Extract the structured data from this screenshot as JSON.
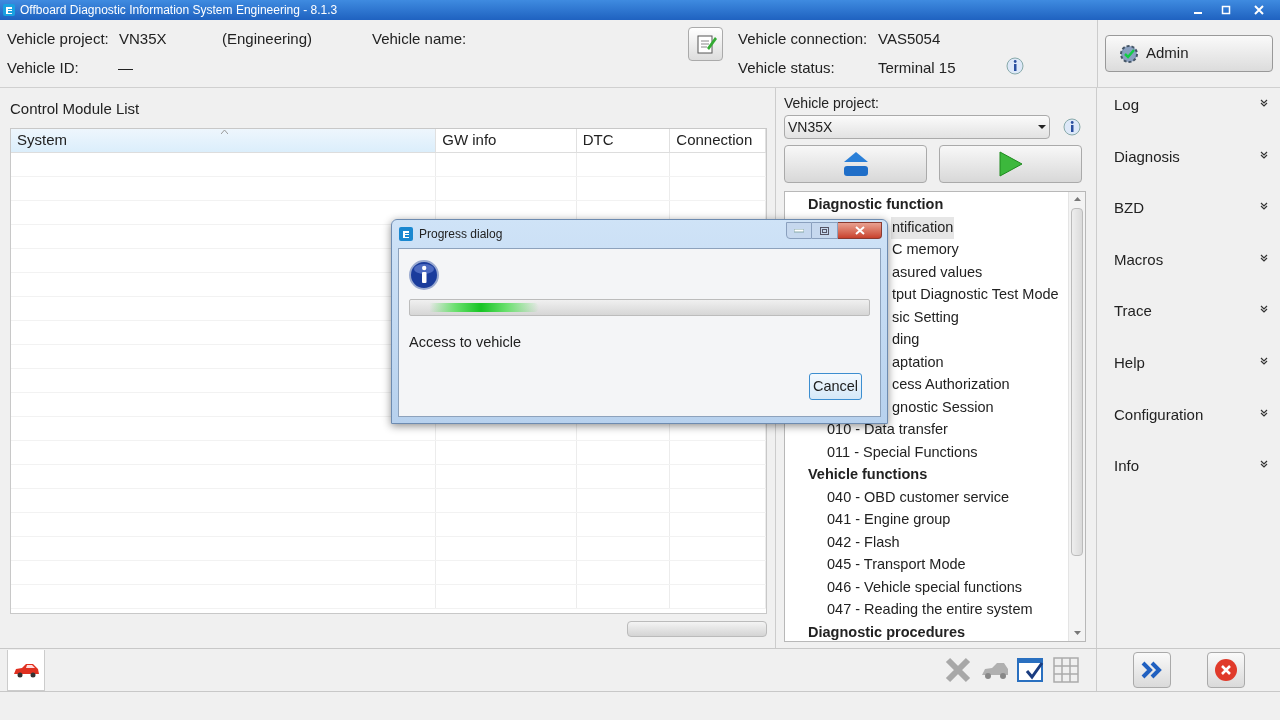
{
  "window": {
    "title": "Offboard Diagnostic Information System Engineering - 8.1.3"
  },
  "vehicle_info": {
    "project_label": "Vehicle project:",
    "project": "VN35X",
    "mode": "(Engineering)",
    "name_label": "Vehicle name:",
    "id_label": "Vehicle ID:",
    "id": "—",
    "connection_label": "Vehicle connection:",
    "connection": "VAS5054",
    "status_label": "Vehicle status:",
    "status": "Terminal 15"
  },
  "admin_button": "Admin",
  "control_module_list": {
    "title": "Control Module List",
    "columns": [
      "System",
      "GW info",
      "DTC",
      "Connection"
    ]
  },
  "vehicle_project": {
    "label": "Vehicle project:",
    "value": "VN35X"
  },
  "tree": [
    {
      "label": "Diagnostic function",
      "children": [
        {
          "label": "ntification",
          "kind": "covered",
          "selected": true
        },
        {
          "label": "C memory",
          "kind": "covered",
          "selected": false
        },
        {
          "label": "asured values",
          "kind": "covered",
          "selected": false
        },
        {
          "label": "tput Diagnostic Test Mode",
          "kind": "covered",
          "selected": false
        },
        {
          "label": "sic Setting",
          "kind": "covered",
          "selected": false
        },
        {
          "label": "ding",
          "kind": "covered",
          "selected": false
        },
        {
          "label": "aptation",
          "kind": "covered",
          "selected": false
        },
        {
          "label": "cess Authorization",
          "kind": "covered",
          "selected": false
        },
        {
          "label": "gnostic Session",
          "kind": "covered",
          "selected": false
        },
        {
          "label": "010 - Data transfer",
          "kind": "item",
          "selected": false
        },
        {
          "label": "011 - Special Functions",
          "kind": "item",
          "selected": false
        }
      ]
    },
    {
      "label": "Vehicle functions",
      "children": [
        {
          "label": "040 - OBD customer service",
          "kind": "item",
          "selected": false
        },
        {
          "label": "041 - Engine group",
          "kind": "item",
          "selected": false
        },
        {
          "label": "042 - Flash",
          "kind": "item",
          "selected": false
        },
        {
          "label": "045 - Transport Mode",
          "kind": "item",
          "selected": false
        },
        {
          "label": "046 - Vehicle special functions",
          "kind": "item",
          "selected": false
        },
        {
          "label": "047 - Reading the entire system",
          "kind": "item",
          "selected": false
        }
      ]
    },
    {
      "label": "Diagnostic procedures"
    }
  ],
  "sidebar": {
    "items": [
      {
        "label": "Log"
      },
      {
        "label": "Diagnosis"
      },
      {
        "label": "BZD"
      },
      {
        "label": "Macros"
      },
      {
        "label": "Trace"
      },
      {
        "label": "Help"
      },
      {
        "label": "Configuration"
      },
      {
        "label": "Info"
      }
    ]
  },
  "dialog": {
    "title": "Progress dialog",
    "message": "Access to vehicle",
    "progress": {
      "level": 0.28
    },
    "cancel_button": "Cancel"
  }
}
